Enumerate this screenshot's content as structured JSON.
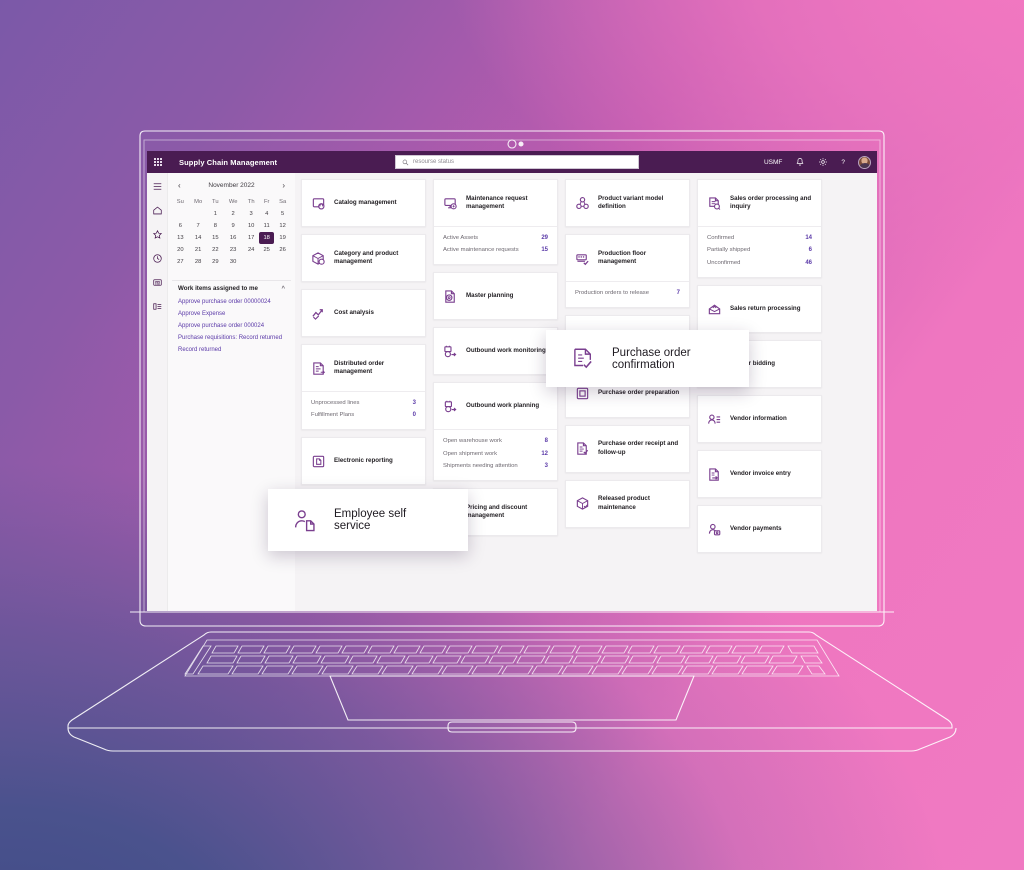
{
  "background": {
    "accent_pink": "#ee76c0",
    "accent_blue": "#46508a",
    "brand_purple": "#4a1c52"
  },
  "header": {
    "waffle_icon": "waffle-grid-icon",
    "title": "Supply Chain Management",
    "search": {
      "icon": "search-icon",
      "placeholder": "resourse status",
      "value": ""
    },
    "company": "USMF",
    "notification_icon": "bell-icon",
    "settings_icon": "gear-icon",
    "help_label": "?",
    "avatar": "user-avatar"
  },
  "rail": {
    "items": [
      {
        "icon": "hamburger-menu-icon",
        "name": "menu"
      },
      {
        "icon": "home-icon",
        "name": "home"
      },
      {
        "icon": "star-icon",
        "name": "favorites"
      },
      {
        "icon": "clock-icon",
        "name": "recent"
      },
      {
        "icon": "modules-icon",
        "name": "modules"
      },
      {
        "icon": "workspaces-icon",
        "name": "workspaces"
      }
    ]
  },
  "calendar": {
    "prev_label": "‹",
    "next_label": "›",
    "title": "November 2022",
    "weekdays": [
      "Su",
      "Mo",
      "Tu",
      "We",
      "Th",
      "Fr",
      "Sa"
    ],
    "weeks": [
      [
        "",
        "",
        "1",
        "2",
        "3",
        "4",
        "5"
      ],
      [
        "6",
        "7",
        "8",
        "9",
        "10",
        "11",
        "12"
      ],
      [
        "13",
        "14",
        "15",
        "16",
        "17",
        "18",
        "19"
      ],
      [
        "20",
        "21",
        "22",
        "23",
        "24",
        "25",
        "26"
      ],
      [
        "27",
        "28",
        "29",
        "30",
        "",
        "",
        ""
      ]
    ],
    "selected": "18"
  },
  "work_items": {
    "title": "Work items assigned to me",
    "collapse_icon": "chevron-up-icon",
    "items": [
      "Approve purchase order 00000024",
      "Approve Expense",
      "Approve purchase order 000024",
      "Purchase requisitions: Record returned",
      "Record returned"
    ]
  },
  "columns": [
    {
      "tiles": [
        {
          "icon": "catalog-icon",
          "label": "Catalog management",
          "kpis": []
        },
        {
          "icon": "category-product-icon",
          "label": "Category and product management",
          "kpis": []
        },
        {
          "icon": "cost-analysis-icon",
          "label": "Cost analysis",
          "kpis": []
        },
        {
          "icon": "distributed-order-icon",
          "label": "Distributed order management",
          "kpis": [
            {
              "k": "Unprocessed lines",
              "v": "3"
            },
            {
              "k": "Fulfillment Plans",
              "v": "0"
            }
          ]
        },
        {
          "icon": "electronic-reporting-icon",
          "label": "Electronic reporting",
          "kpis": []
        }
      ]
    },
    {
      "tiles": [
        {
          "icon": "maintenance-request-icon",
          "label": "Maintenance request management",
          "kpis": [
            {
              "k": "Active Assets",
              "v": "29"
            },
            {
              "k": "Active maintenance requests",
              "v": "15"
            }
          ]
        },
        {
          "icon": "master-planning-icon",
          "label": "Master planning",
          "kpis": []
        },
        {
          "icon": "outbound-work-monitoring-icon",
          "label": "Outbound work monitoring",
          "kpis": []
        },
        {
          "icon": "outbound-work-planning-icon",
          "label": "Outbound work planning",
          "kpis": [
            {
              "k": "Open warehouse work",
              "v": "8"
            },
            {
              "k": "Open shipment work",
              "v": "12"
            },
            {
              "k": "Shipments needing attention",
              "v": "3"
            }
          ]
        },
        {
          "icon": "pricing-discount-icon",
          "label": "Pricing and discount management",
          "kpis": []
        }
      ]
    },
    {
      "tiles": [
        {
          "icon": "product-variant-icon",
          "label": "Product variant model definition",
          "kpis": []
        },
        {
          "icon": "production-floor-icon",
          "label": "Production floor management",
          "kpis": [
            {
              "k": "Production orders to release",
              "v": "7"
            }
          ]
        },
        {
          "icon": "purchase-order-confirmation-icon",
          "label": "Purchase order confirmation",
          "kpis": []
        },
        {
          "icon": "purchase-order-preparation-icon",
          "label": "Purchase order preparation",
          "kpis": []
        },
        {
          "icon": "purchase-order-receipt-icon",
          "label": "Purchase order receipt and follow-up",
          "kpis": []
        },
        {
          "icon": "released-product-icon",
          "label": "Released product maintenance",
          "kpis": []
        }
      ]
    },
    {
      "tiles": [
        {
          "icon": "sales-order-icon",
          "label": "Sales order processing and inquiry",
          "kpis": [
            {
              "k": "Confirmed",
              "v": "14"
            },
            {
              "k": "Partially shipped",
              "v": "6"
            },
            {
              "k": "Unconfirmed",
              "v": "46"
            }
          ]
        },
        {
          "icon": "sales-return-icon",
          "label": "Sales return processing",
          "kpis": []
        },
        {
          "icon": "vendor-bidding-icon",
          "label": "Vendor bidding",
          "kpis": []
        },
        {
          "icon": "vendor-information-icon",
          "label": "Vendor information",
          "kpis": []
        },
        {
          "icon": "vendor-invoice-icon",
          "label": "Vendor invoice entry",
          "kpis": []
        },
        {
          "icon": "vendor-payments-icon",
          "label": "Vendor payments",
          "kpis": []
        }
      ]
    }
  ],
  "callouts": {
    "purchase_order": {
      "icon": "purchase-order-confirmation-icon",
      "label": "Purchase order confirmation"
    },
    "employee_self_service": {
      "icon": "employee-self-service-icon",
      "label": "Employee self service"
    }
  }
}
